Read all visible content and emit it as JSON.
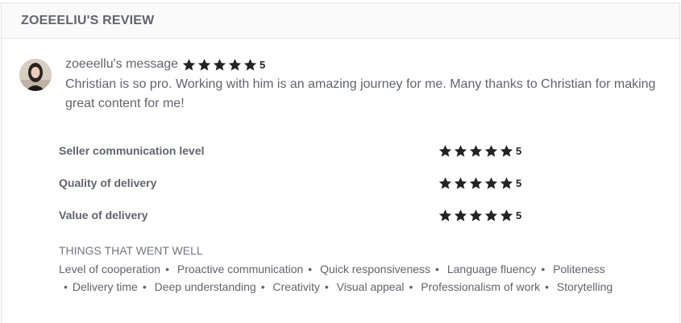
{
  "header": {
    "title": "ZOEEELIU'S REVIEW"
  },
  "review": {
    "author_message_label": "zoeeellu's message",
    "rating": 5,
    "rating_text": "5",
    "body": "Christian is so pro. Working with him is an amazing journey for me. Many thanks to Christian for making great content for me!"
  },
  "ratings": [
    {
      "label": "Seller communication level",
      "value": 5,
      "value_text": "5"
    },
    {
      "label": "Quality of delivery",
      "value": 5,
      "value_text": "5"
    },
    {
      "label": "Value of delivery",
      "value": 5,
      "value_text": "5"
    }
  ],
  "went_well": {
    "title": "THINGS THAT WENT WELL",
    "items": [
      "Level of cooperation",
      "Proactive communication",
      "Quick responsiveness",
      "Language fluency",
      "Politeness",
      "Delivery time",
      "Deep understanding",
      "Creativity",
      "Visual appeal",
      "Professionalism of work",
      "Storytelling"
    ]
  },
  "colors": {
    "star": "#222325",
    "text": "#62646a",
    "header_bg": "#fafafa"
  },
  "icons": {
    "star": "star-icon",
    "avatar": "user-avatar-photo"
  }
}
